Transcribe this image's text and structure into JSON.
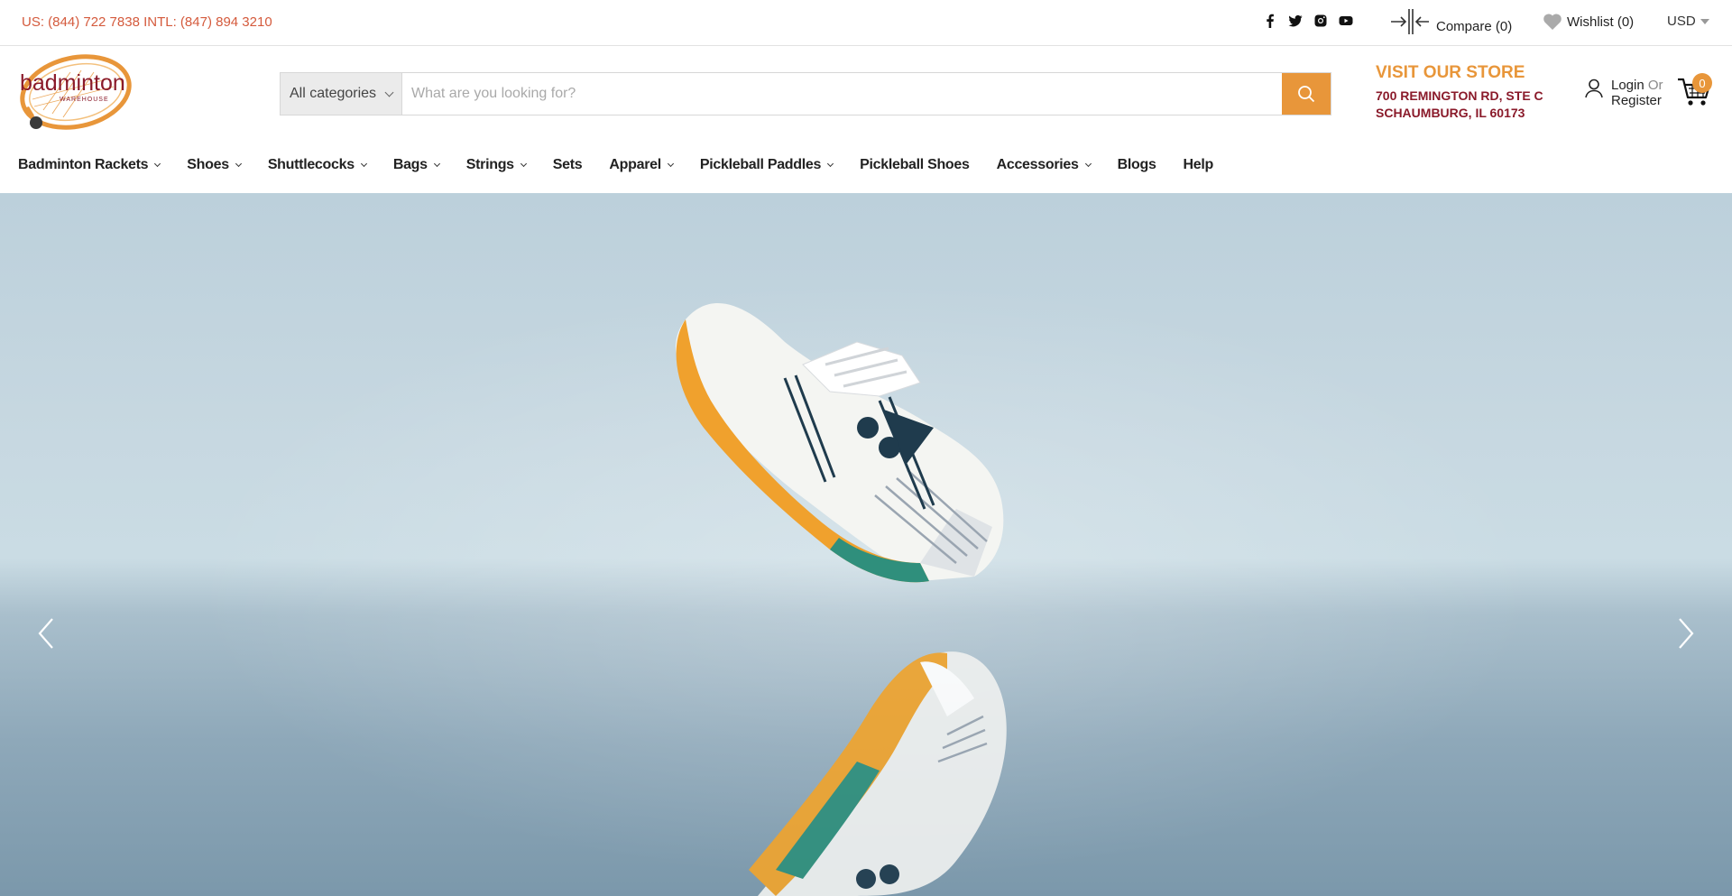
{
  "topbar": {
    "phones": "US: (844) 722 7838 INTL: (847) 894 3210",
    "social": [
      "facebook-icon",
      "twitter-icon",
      "instagram-icon",
      "youtube-icon"
    ],
    "compare_label": "Compare (0)",
    "wishlist_label": "Wishlist (0)",
    "currency": "USD"
  },
  "logo": {
    "text": "badminton",
    "subtext": "WAREHOUSE"
  },
  "search": {
    "category": "All categories",
    "placeholder": "What are you looking for?"
  },
  "store": {
    "title": "VISIT OUR STORE",
    "address_line1": "700 REMINGTON RD, STE C",
    "address_line2": "SCHAUMBURG, IL 60173"
  },
  "account": {
    "login": "Login",
    "or": "Or",
    "register": "Register"
  },
  "cart": {
    "count": "0"
  },
  "nav": {
    "items": [
      {
        "label": "Badminton Rackets",
        "dropdown": true
      },
      {
        "label": "Shoes",
        "dropdown": true
      },
      {
        "label": "Shuttlecocks",
        "dropdown": true
      },
      {
        "label": "Bags",
        "dropdown": true
      },
      {
        "label": "Strings",
        "dropdown": true
      },
      {
        "label": "Sets",
        "dropdown": false
      },
      {
        "label": "Apparel",
        "dropdown": true
      },
      {
        "label": "Pickleball Paddles",
        "dropdown": true
      },
      {
        "label": "Pickleball Shoes",
        "dropdown": false
      },
      {
        "label": "Accessories",
        "dropdown": true
      },
      {
        "label": "Blogs",
        "dropdown": false
      },
      {
        "label": "Help",
        "dropdown": false
      }
    ]
  },
  "colors": {
    "accent": "#e8963a",
    "phone": "#d45a3c",
    "address": "#8a1a2a"
  }
}
